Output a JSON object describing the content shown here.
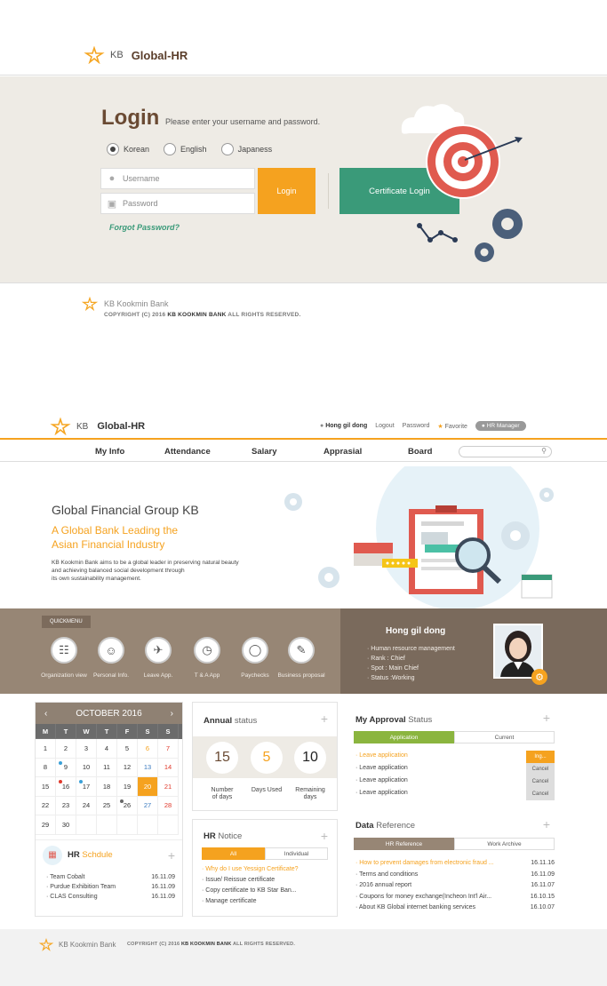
{
  "login": {
    "brand_kb": "KB",
    "brand_name": "Global-HR",
    "title": "Login",
    "desc": "Please enter your username and password.",
    "languages": [
      "Korean",
      "English",
      "Japaness"
    ],
    "username_placeholder": "Username",
    "password_placeholder": "Password",
    "login_button": "Login",
    "cert_button": "Certificate Login",
    "forgot": "Forgot Password?",
    "footer_bank": "KB Kookmin Bank",
    "footer_copy_a": "COPYRIGHT (C) 2016 ",
    "footer_copy_b": "KB KOOKMIN BANK",
    "footer_copy_c": " ALL RIGHTS RESERVED."
  },
  "header": {
    "brand_kb": "KB",
    "brand_name": "Global-HR",
    "user": "Hong gil dong",
    "logout": "Logout",
    "password": "Password",
    "favorite": "Favorite",
    "role": "HR Manager"
  },
  "nav": [
    "My Info",
    "Attendance",
    "Salary",
    "Apprasial",
    "Board"
  ],
  "hero": {
    "title": "Global Financial Group KB",
    "sub1": "A Global Bank Leading the",
    "sub2": "Asian Financial Industry",
    "body1": "KB Kookmin Bank aims to be a global leader in preserving natural beauty",
    "body2": "and achieving balanced social development through",
    "body3": "its own sustainability management."
  },
  "quickmenu": {
    "label": "QUICKMENU",
    "items": [
      "Organization view",
      "Personal Info.",
      "Leave App.",
      "T & A App",
      "Paychecks",
      "Business proposal"
    ]
  },
  "profile": {
    "name": "Hong gil dong",
    "lines": [
      "Human resource management",
      "Rank : Chief",
      "Spot : Main Chief",
      "Status :Working"
    ]
  },
  "calendar": {
    "month": "OCTOBER",
    "year": "2016",
    "days": [
      "M",
      "T",
      "W",
      "T",
      "F",
      "S",
      "S"
    ],
    "weeks": [
      [
        "1",
        "2",
        "3",
        "4",
        "5",
        "6",
        "7"
      ],
      [
        "8",
        "9",
        "10",
        "11",
        "12",
        "13",
        "14"
      ],
      [
        "15",
        "16",
        "17",
        "18",
        "19",
        "20",
        "21"
      ],
      [
        "22",
        "23",
        "24",
        "25",
        "26",
        "27",
        "28"
      ],
      [
        "29",
        "30",
        "",
        "",
        "",
        "",
        ""
      ]
    ]
  },
  "schedule": {
    "title_a": "HR",
    "title_b": " Schdule",
    "items": [
      {
        "name": "Team Cobalt",
        "date": "16.11.09"
      },
      {
        "name": "Purdue Exhibition Team",
        "date": "16.11.09"
      },
      {
        "name": "CLAS Consulting",
        "date": "16.11.09"
      }
    ]
  },
  "annual": {
    "title_a": "Annual",
    "title_b": " status",
    "values": [
      "15",
      "5",
      "10"
    ],
    "labels": [
      [
        "Number",
        "of days"
      ],
      [
        "Days Used",
        ""
      ],
      [
        "Remaining",
        "days"
      ]
    ]
  },
  "notice": {
    "title_a": "HR",
    "title_b": " Notice",
    "tabs": [
      "All",
      "Individual"
    ],
    "items": [
      "Why do I use Yessign Certificate?",
      "Issue/ Reissue certificate",
      "Copy certificate to KB Star Ban...",
      "Manage certificate"
    ]
  },
  "approval": {
    "title_a": "My Approval",
    "title_b": " Status",
    "tabs": [
      "Application",
      "Current"
    ],
    "items": [
      {
        "text": "Leave application",
        "tag": "Ing..."
      },
      {
        "text": "Leave application",
        "tag": "Cancel"
      },
      {
        "text": "Leave application",
        "tag": "Cancel"
      },
      {
        "text": "Leave application",
        "tag": "Cancel"
      }
    ]
  },
  "data_ref": {
    "title_a": "Data",
    "title_b": " Reference",
    "tabs": [
      "HR Reference",
      "Work Archive"
    ],
    "items": [
      {
        "text": "How to prevent damages from electronic fraud ...",
        "date": "16.11.16"
      },
      {
        "text": "Terms and conditions",
        "date": "16.11.09"
      },
      {
        "text": "2016 annual report",
        "date": "16.11.07"
      },
      {
        "text": "Coupons for money exchange(Incheon Int'l Air...",
        "date": "16.10.15"
      },
      {
        "text": "About KB Global internet banking services",
        "date": "16.10.07"
      }
    ]
  },
  "footer": {
    "bank": "KB Kookmin Bank",
    "copy_a": "COPYRIGHT (C) 2016 ",
    "copy_b": "KB KOOKMIN BANK",
    "copy_c": " ALL RIGHTS RESERVED."
  },
  "colors": {
    "accent": "#f5a21f",
    "green": "#3a9a79",
    "brown": "#6a4a33",
    "red": "#e05a4f"
  }
}
